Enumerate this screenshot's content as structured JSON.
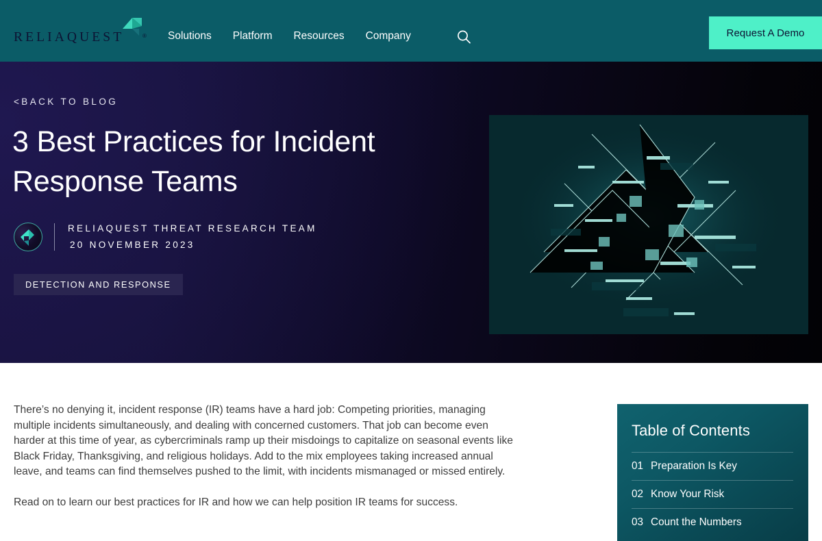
{
  "header": {
    "logo_text": "RELIAQUEST",
    "logo_registered": "®",
    "nav": [
      {
        "label": "Solutions"
      },
      {
        "label": "Platform"
      },
      {
        "label": "Resources"
      },
      {
        "label": "Company"
      }
    ],
    "search_icon": "search-icon",
    "cta_label": "Request A Demo",
    "bg_color": "#0b5c67",
    "cta_color": "#4ef0c8"
  },
  "hero": {
    "back_link": "<BACK TO BLOG",
    "title": "3 Best Practices for Incident Response Teams",
    "author": "RELIAQUEST THREAT RESEARCH TEAM",
    "date": "20 NOVEMBER 2023",
    "tag": "DETECTION AND RESPONSE",
    "avatar_icon": "reliaquest-avatar-icon",
    "figure_alt": "abstract-circuit-network-image",
    "bg_start": "#151038",
    "bg_end": "#020205"
  },
  "article": {
    "paragraphs": [
      "There’s no denying it, incident response (IR) teams have a hard job: Competing priorities, managing multiple incidents simultaneously, and dealing with concerned customers. That job can become even harder at this time of year, as cybercriminals ramp up their misdoings to capitalize on seasonal events like Black Friday, Thanksgiving, and religious holidays. Add to the mix employees taking increased annual leave, and teams can find themselves pushed to the limit, with incidents mismanaged or missed entirely.",
      "Read on to learn our best practices for IR and how we can help position IR teams for success."
    ]
  },
  "toc": {
    "title": "Table of Contents",
    "accent_color": "#0d5864",
    "items": [
      {
        "num": "01",
        "label": "Preparation Is Key"
      },
      {
        "num": "02",
        "label": "Know Your Risk"
      },
      {
        "num": "03",
        "label": "Count the Numbers"
      }
    ]
  }
}
